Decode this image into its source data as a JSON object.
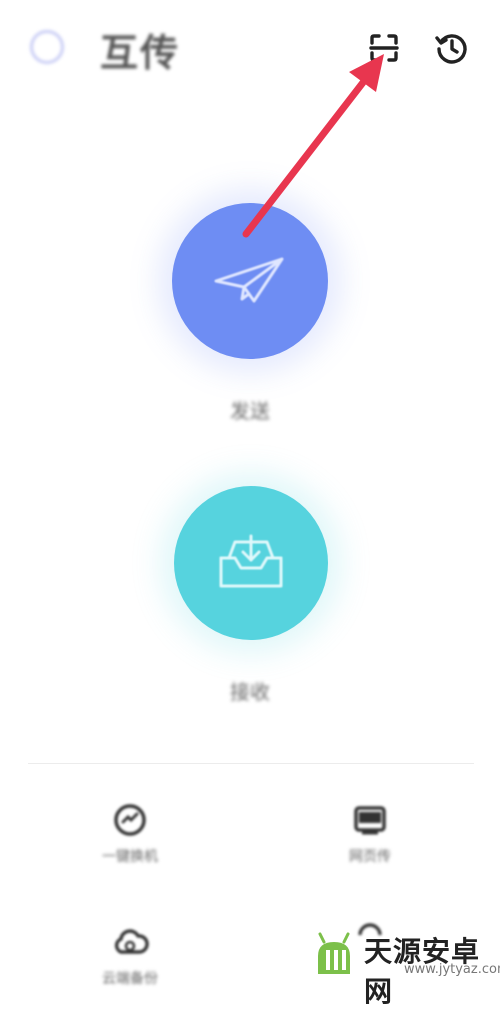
{
  "header": {
    "title": "互传",
    "scan_icon": "scan-icon",
    "history_icon": "history-icon"
  },
  "send": {
    "label": "发送",
    "icon": "paper-plane-icon",
    "color": "#6e8df3"
  },
  "receive": {
    "label": "接收",
    "icon": "inbox-download-icon",
    "color": "#56d3de"
  },
  "tools": [
    {
      "label": "一键换机",
      "icon": "phone-clone-icon"
    },
    {
      "label": "网页传",
      "icon": "web-transfer-icon"
    },
    {
      "label": "云端备份",
      "icon": "cloud-backup-icon"
    },
    {
      "label": "",
      "icon": "more-icon"
    }
  ],
  "annotation": {
    "color": "#e8364f",
    "target": "scan-button"
  },
  "watermark": {
    "text": "天源安卓网",
    "sub": "www.jytyaz.com"
  }
}
